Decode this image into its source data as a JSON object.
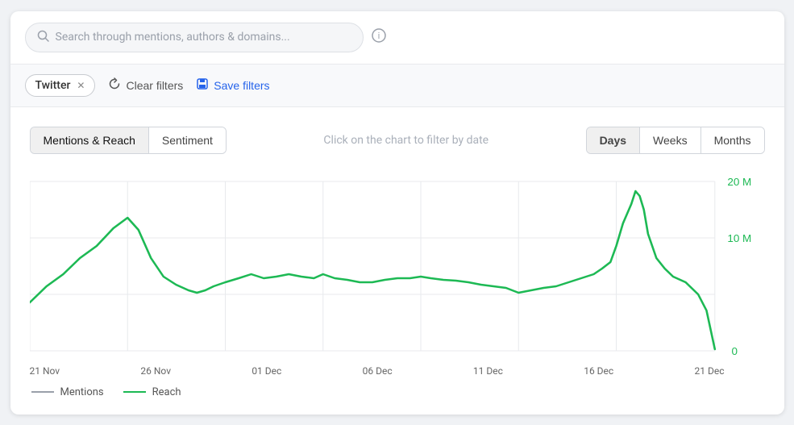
{
  "search": {
    "placeholder": "Search through mentions, authors & domains..."
  },
  "filters": {
    "active_tag": "Twitter",
    "clear_label": "Clear filters",
    "save_label": "Save filters"
  },
  "chart": {
    "tabs": [
      {
        "label": "Mentions & Reach",
        "active": true
      },
      {
        "label": "Sentiment",
        "active": false
      }
    ],
    "hint": "Click on the chart to filter by date",
    "periods": [
      {
        "label": "Days",
        "active": true
      },
      {
        "label": "Weeks",
        "active": false
      },
      {
        "label": "Months",
        "active": false
      }
    ],
    "y_axis": {
      "max": "20 M",
      "mid": "10 M",
      "min": "0"
    },
    "x_labels": [
      "21 Nov",
      "26 Nov",
      "01 Dec",
      "06 Dec",
      "11 Dec",
      "16 Dec",
      "21 Dec"
    ],
    "legend": [
      {
        "label": "Mentions",
        "type": "mentions"
      },
      {
        "label": "Reach",
        "type": "reach"
      }
    ],
    "colors": {
      "reach": "#1db954",
      "mentions": "#9aa0aa",
      "grid": "#e8eaed",
      "accent_blue": "#2563eb"
    }
  }
}
